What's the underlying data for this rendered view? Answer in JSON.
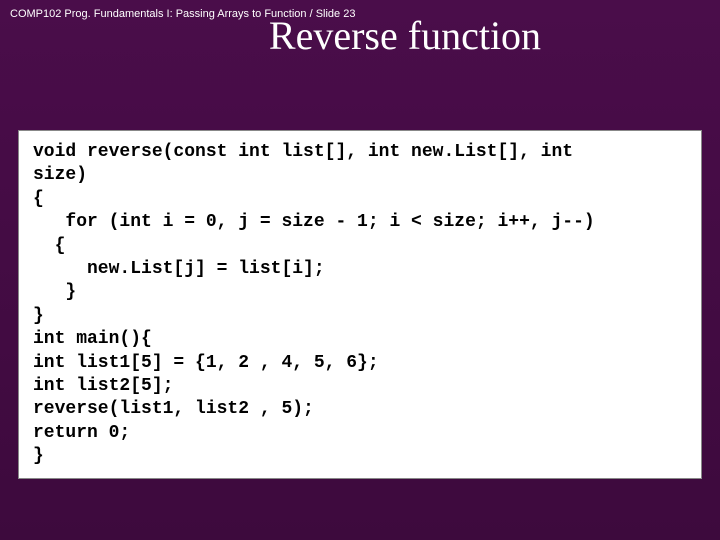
{
  "breadcrumb": "COMP102 Prog. Fundamentals I: Passing Arrays to Function / Slide 23",
  "title": "Reverse function",
  "code": "void reverse(const int list[], int new.List[], int\nsize)\n{\n   for (int i = 0, j = size - 1; i < size; i++, j--)\n  {\n     new.List[j] = list[i];\n   }\n}\nint main(){\nint list1[5] = {1, 2 , 4, 5, 6};\nint list2[5];\nreverse(list1, list2 , 5);\nreturn 0;\n}"
}
